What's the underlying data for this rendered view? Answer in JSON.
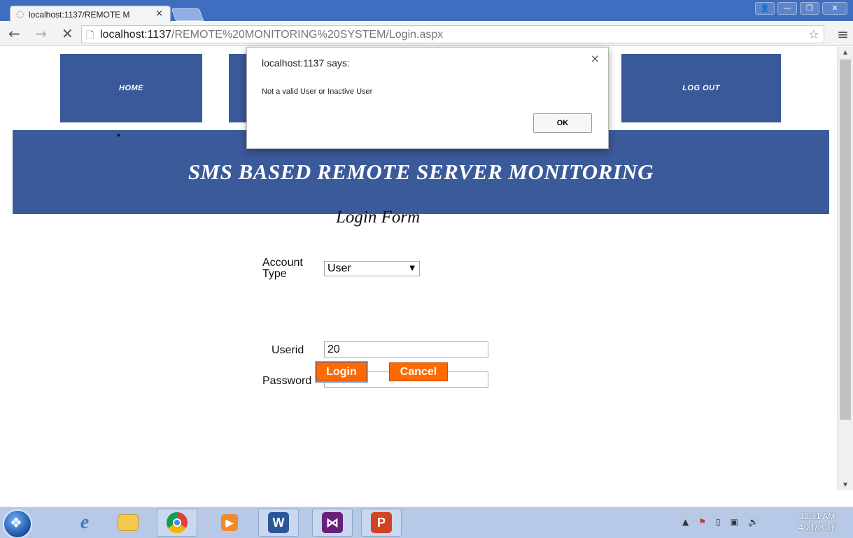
{
  "browser": {
    "tab_title": "localhost:1137/REMOTE M",
    "tab_close": "×",
    "url_host": "localhost:1137",
    "url_path": "/REMOTE%20MONITORING%20SYSTEM/Login.aspx",
    "back_icon": "←",
    "forward_icon": "→",
    "stop_icon": "✕",
    "star_icon": "☆",
    "menu_icon": "≡",
    "window_controls": {
      "user": "👤",
      "minimize": "—",
      "restore": "❐",
      "close": "✕"
    }
  },
  "nav": {
    "home": "HOME",
    "logout": "LOG OUT"
  },
  "banner": {
    "title": "SMS BASED REMOTE  SERVER MONITORING"
  },
  "form": {
    "title": "Login Form",
    "account_type_label": "Account Type",
    "account_type_value": "User",
    "userid_label": "Userid",
    "userid_value": "20",
    "password_label": "Password",
    "password_value": "•••",
    "login_button": "Login",
    "cancel_button": "Cancel"
  },
  "dialog": {
    "title": "localhost:1137 says:",
    "message": "Not a valid User or Inactive User",
    "ok_button": "OK",
    "close_icon": "×"
  },
  "taskbar": {
    "items": [
      "ie-icon",
      "file-explorer-icon",
      "chrome-icon",
      "media-player-icon",
      "word-icon",
      "visual-studio-icon",
      "powerpoint-icon"
    ],
    "clock_time": "12:31 AM",
    "clock_date": "4/21/2016"
  },
  "colors": {
    "nav_blue": "#3a5998",
    "button_orange": "#ff6a00",
    "taskbar": "#b7c9e6"
  }
}
